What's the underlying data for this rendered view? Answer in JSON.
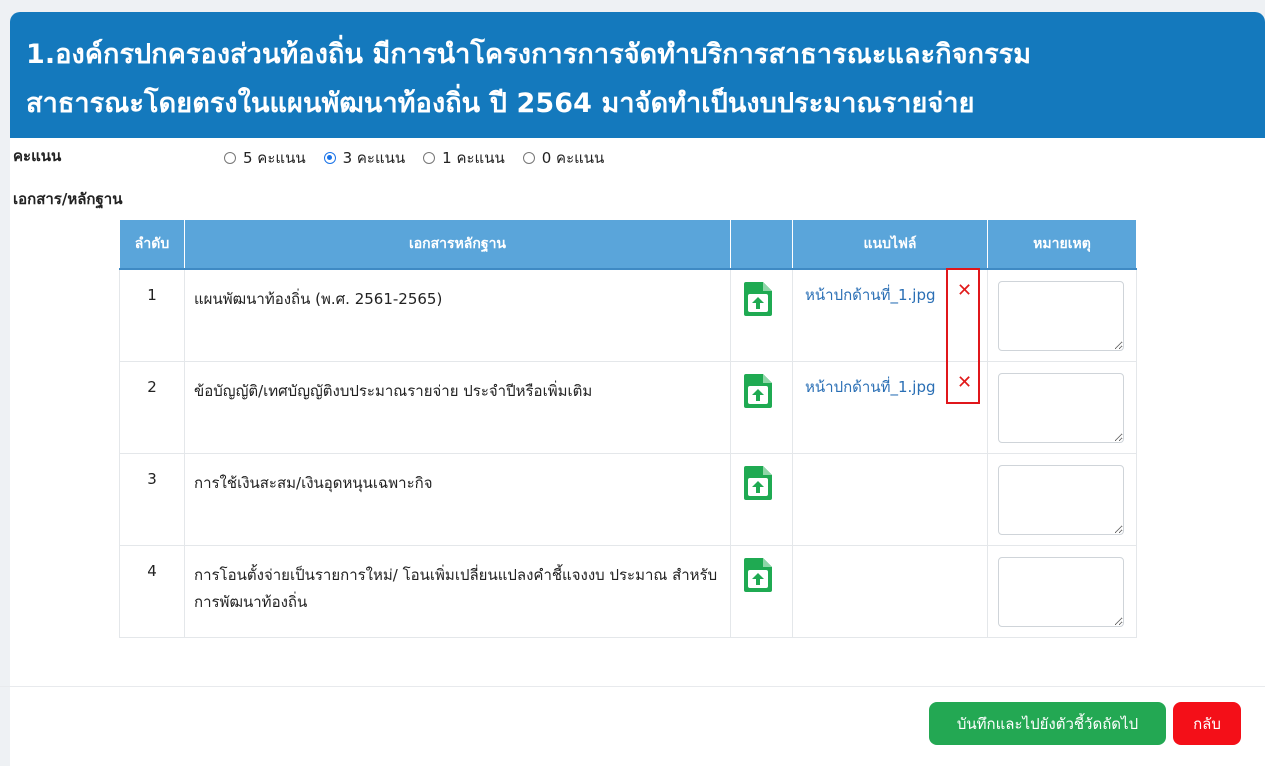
{
  "header": {
    "title_line1": "1.องค์กรปกครองส่วนท้องถิ่น มีการนำโครงการการจัดทำบริการสาธารณะและกิจกรรม",
    "title_line2": "สาธารณะโดยตรงในแผนพัฒนาท้องถิ่น ปี 2564 มาจัดทำเป็นงบประมาณรายจ่าย"
  },
  "score": {
    "label": "คะแนน",
    "options": [
      {
        "label": "5 คะแนน",
        "checked": false
      },
      {
        "label": "3 คะแนน",
        "checked": true
      },
      {
        "label": "1 คะแนน",
        "checked": false
      },
      {
        "label": "0 คะแนน",
        "checked": false
      }
    ]
  },
  "documents": {
    "label": "เอกสาร/หลักฐาน",
    "columns": {
      "no": "ลำดับ",
      "doc": "เอกสารหลักฐาน",
      "upload": "",
      "file": "แนบไฟล์",
      "note": "หมายเหตุ"
    },
    "rows": [
      {
        "no": "1",
        "doc": "แผนพัฒนาท้องถิ่น (พ.ศ. 2561-2565)",
        "file": "หน้าปกด้านที่_1.jpg",
        "has_file": true
      },
      {
        "no": "2",
        "doc": "ข้อบัญญัติ/เทศบัญญัติงบประมาณรายจ่าย ประจำปีหรือเพิ่มเติม",
        "file": "หน้าปกด้านที่_1.jpg",
        "has_file": true
      },
      {
        "no": "3",
        "doc": "การใช้เงินสะสม/เงินอุดหนุนเฉพาะกิจ",
        "file": "",
        "has_file": false
      },
      {
        "no": "4",
        "doc": "การโอนตั้งจ่ายเป็นรายการใหม่/ โอนเพิ่มเปลี่ยนแปลงคำชี้แจงงบ ประมาณ สำหรับการพัฒนาท้องถิ่น",
        "file": "",
        "has_file": false
      }
    ],
    "upload_icon": "file-upload-icon",
    "remove_icon": "close-icon",
    "remove_symbol": "✕"
  },
  "buttons": {
    "save_next": "บันทึกและไปยังตัวชี้วัดถัดไป",
    "back": "กลับ"
  },
  "colors": {
    "header_bg": "#1479bd",
    "table_header_bg": "#5aa5da",
    "save_button": "#23a853",
    "back_button": "#f40f18",
    "remove_icon": "#e11a1a",
    "upload_icon": "#1faa52",
    "highlight": "#e0161b"
  }
}
